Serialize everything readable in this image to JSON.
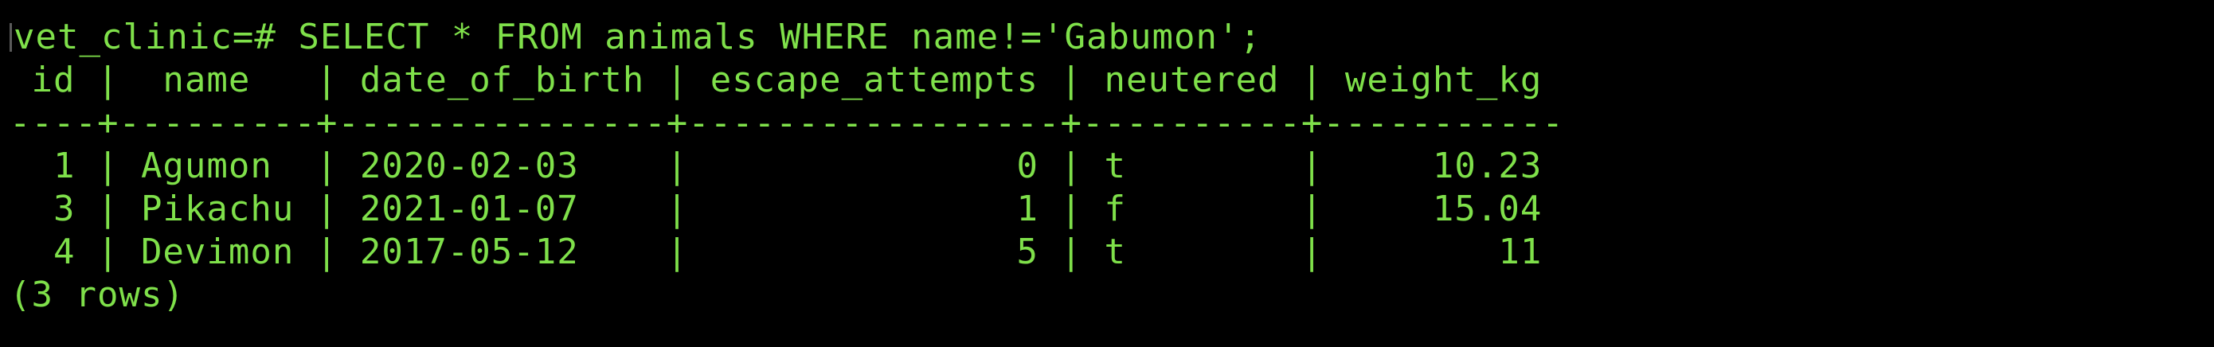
{
  "colors": {
    "background": "#000000",
    "text": "#7fe04a"
  },
  "terminal": {
    "prompt": "vet_clinic=#",
    "command": " SELECT * FROM animals WHERE name!='Gabumon';",
    "header": " id |  name   | date_of_birth | escape_attempts | neutered | weight_kg",
    "separator": "----+---------+---------------+-----------------+----------+-----------",
    "rows": [
      "  1 | Agumon  | 2020-02-03    |               0 | t        |     10.23",
      "  3 | Pikachu | 2021-01-07    |               1 | f        |     15.04",
      "  4 | Devimon | 2017-05-12    |               5 | t        |        11"
    ],
    "footer": "(3 rows)"
  }
}
